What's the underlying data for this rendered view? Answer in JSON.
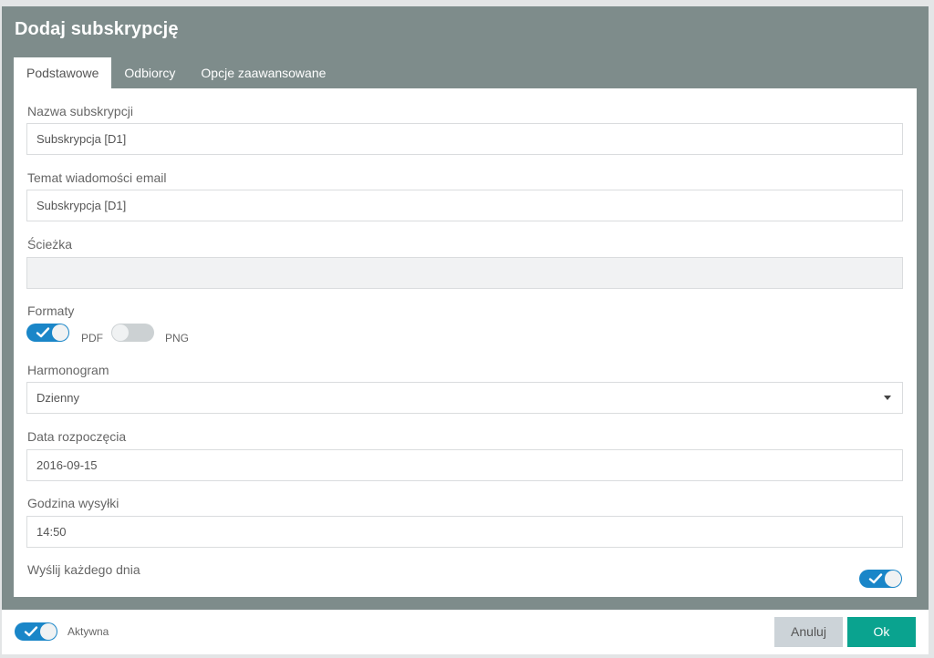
{
  "dialog": {
    "title": "Dodaj subskrypcję"
  },
  "tabs": [
    {
      "label": "Podstawowe",
      "active": true
    },
    {
      "label": "Odbiorcy",
      "active": false
    },
    {
      "label": "Opcje zaawansowane",
      "active": false
    }
  ],
  "form": {
    "name": {
      "label": "Nazwa subskrypcji",
      "value": "Subskrypcja [D1]"
    },
    "subject": {
      "label": "Temat wiadomości email",
      "value": "Subskrypcja [D1]"
    },
    "path": {
      "label": "Ścieżka",
      "value": ""
    },
    "formats": {
      "label": "Formaty",
      "pdf": {
        "label": "PDF",
        "on": true
      },
      "png": {
        "label": "PNG",
        "on": false
      }
    },
    "schedule": {
      "label": "Harmonogram",
      "value": "Dzienny"
    },
    "start_date": {
      "label": "Data rozpoczęcia",
      "value": "2016-09-15"
    },
    "send_time": {
      "label": "Godzina wysyłki",
      "value": "14:50"
    },
    "every_day": {
      "label": "Wyślij każdego dnia",
      "on": true
    }
  },
  "footer": {
    "active": {
      "label": "Aktywna",
      "on": true
    },
    "cancel_label": "Anuluj",
    "ok_label": "Ok"
  },
  "colors": {
    "header_bg": "#7e8c8b",
    "toggle_on": "#1a86c8",
    "toggle_off": "#ccd1d3",
    "ok_button": "#0aa38f",
    "cancel_button": "#ccd3d8"
  },
  "icons": {
    "check": "check-icon",
    "dropdown": "caret-down-icon"
  }
}
